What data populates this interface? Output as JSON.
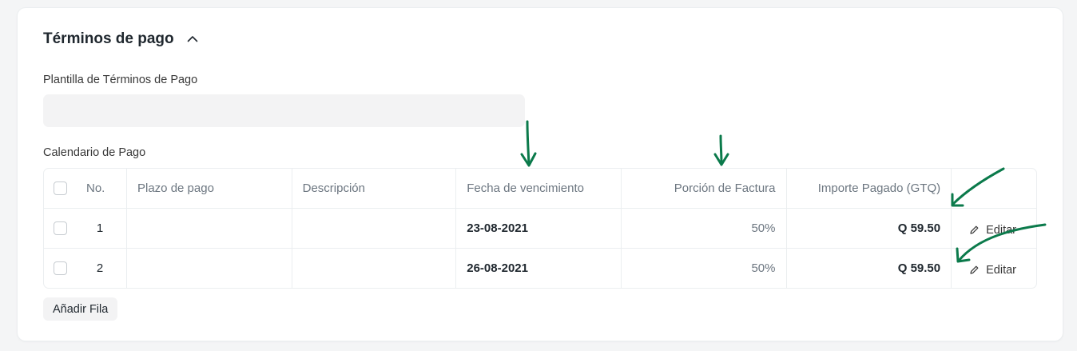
{
  "section": {
    "title": "Términos de pago"
  },
  "template_field": {
    "label": "Plantilla de Términos de Pago",
    "value": ""
  },
  "schedule": {
    "label": "Calendario de Pago",
    "columns": {
      "no": "No.",
      "plazo": "Plazo de pago",
      "descripcion": "Descripción",
      "fecha": "Fecha de vencimiento",
      "porcion": "Porción de Factura",
      "importe": "Importe Pagado (GTQ)"
    },
    "rows": [
      {
        "no": "1",
        "plazo": "",
        "descripcion": "",
        "fecha": "23-08-2021",
        "porcion": "50%",
        "importe": "Q 59.50",
        "edit": "Editar"
      },
      {
        "no": "2",
        "plazo": "",
        "descripcion": "",
        "fecha": "26-08-2021",
        "porcion": "50%",
        "importe": "Q 59.50",
        "edit": "Editar"
      }
    ],
    "add_row": "Añadir Fila"
  },
  "icons": {
    "collapse": "chevron-up-icon",
    "edit": "pencil-icon"
  },
  "colors": {
    "annotation": "#0b7a4b",
    "border": "#ebeef0",
    "input_bg": "#f3f3f4"
  }
}
